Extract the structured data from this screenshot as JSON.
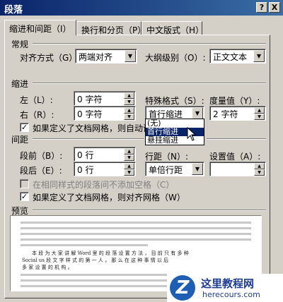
{
  "window": {
    "title": "段落",
    "help_btn": "?",
    "close_btn": "X"
  },
  "tabs": [
    {
      "label": "缩进和间距（I）"
    },
    {
      "label": "换行和分页（P）"
    },
    {
      "label": "中文版式（H）"
    }
  ],
  "general": {
    "heading": "常规",
    "align_label": "对齐方式（G）:",
    "align_value": "两端对齐",
    "outline_label": "大纲级别（O）:",
    "outline_value": "正文文本"
  },
  "indent": {
    "heading": "缩进",
    "left_label": "左（L）:",
    "left_value": "0 字符",
    "right_label": "右（R）:",
    "right_value": "0 字符",
    "special_label": "特殊格式（S）:",
    "special_value": "首行缩进",
    "amount_label": "度量值（Y）:",
    "amount_value": "2 字符",
    "grid_check_label": "如果定义了文档网格，则自动调",
    "options": [
      "(无)",
      "首行缩进",
      "悬挂缩进"
    ]
  },
  "spacing": {
    "heading": "间距",
    "before_label": "段前（B）:",
    "before_value": "0 行",
    "after_label": "段后（E）:",
    "after_value": "0 行",
    "line_label": "行距（N）:",
    "line_value": "单倍行距",
    "at_label": "设置值（A）:",
    "at_value": "",
    "no_space_label": "在相同样式的段落间不添加空格（C）",
    "snap_label": "如果定义了文档网格，则对齐网格（W）"
  },
  "preview": {
    "heading": "预览",
    "line1": "本 段 为 大 家 讲 解 Word 里 的 段 落 设 置 方 法 ， 目 前 只 有 多 种",
    "line2": "Social us 段 文 字 样 式 的 第 一 人 ， 那 么 在 这 种 事 情 以 后",
    "line3": "多 家 设 置 的 机 构 。"
  },
  "watermark": {
    "name": "这里教程网",
    "url": "herecours.com",
    "logo": "Z"
  }
}
